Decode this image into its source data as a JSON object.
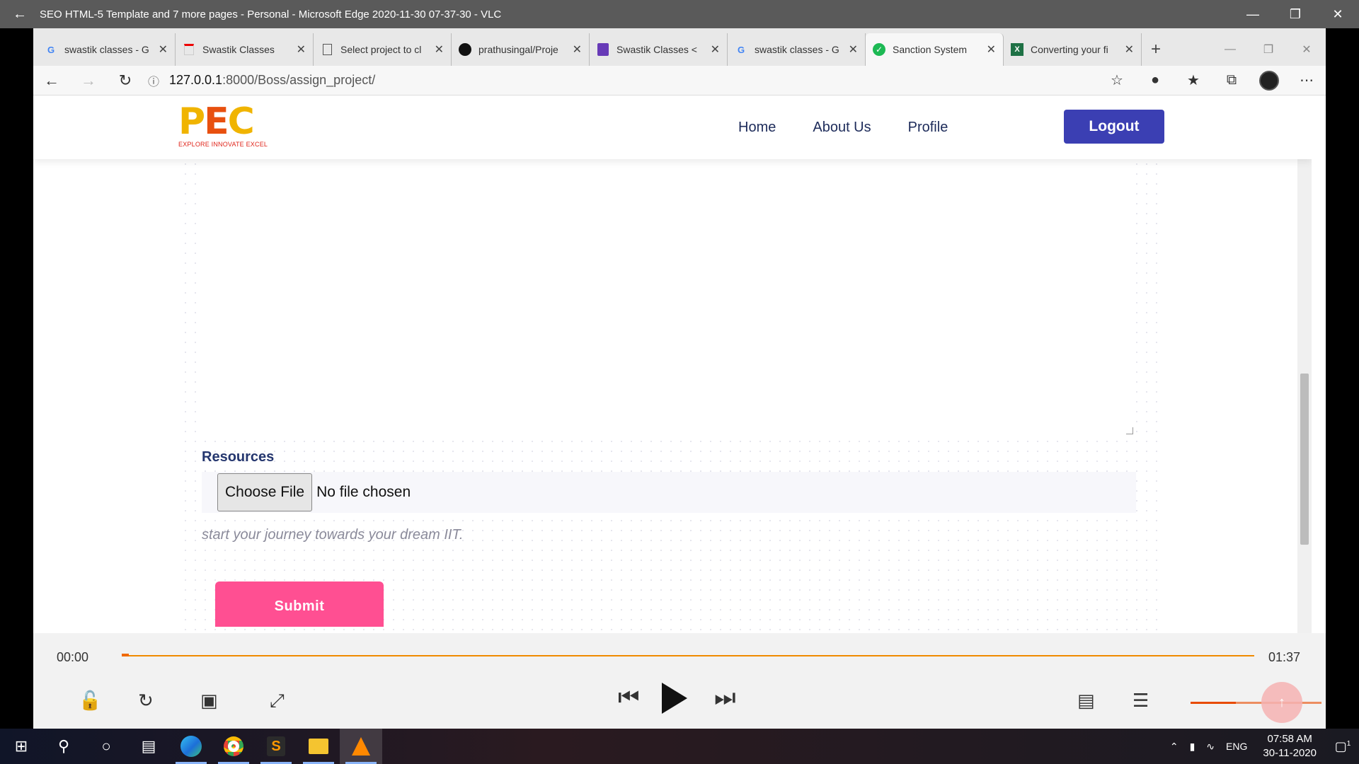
{
  "vlc": {
    "title": "SEO HTML-5 Template and 7 more pages - Personal - Microsoft Edge 2020-11-30 07-37-30 - VLC",
    "time_current": "00:00",
    "time_total": "01:37",
    "progress": 0.0
  },
  "browser": {
    "tabs": [
      {
        "label": "swastik classes - G",
        "icon": "google-icon"
      },
      {
        "label": "Swastik Classes",
        "icon": "page-icon"
      },
      {
        "label": "Select project to cl",
        "icon": "document-icon"
      },
      {
        "label": "prathusingal/Proje",
        "icon": "github-icon"
      },
      {
        "label": "Swastik Classes <",
        "icon": "form-icon"
      },
      {
        "label": "swastik classes - G",
        "icon": "google-icon"
      },
      {
        "label": "Sanction System",
        "icon": "check-icon"
      },
      {
        "label": "Converting your fi",
        "icon": "excel-icon"
      }
    ],
    "url_host": "127.0.0.1",
    "url_path": ":8000/Boss/assign_project/"
  },
  "site": {
    "logo_letters": "PEC",
    "logo_tagline": "EXPLORE INNOVATE EXCEL",
    "nav": {
      "home": "Home",
      "about": "About Us",
      "profile": "Profile"
    },
    "logout": "Logout"
  },
  "form": {
    "resources_label": "Resources",
    "choose_file": "Choose File",
    "no_file": "No file chosen",
    "hint": "start your journey towards your dream IIT.",
    "submit": "Submit"
  },
  "taskbar": {
    "lang": "ENG",
    "time": "07:58 AM",
    "date": "30-11-2020",
    "notifications": "1"
  }
}
